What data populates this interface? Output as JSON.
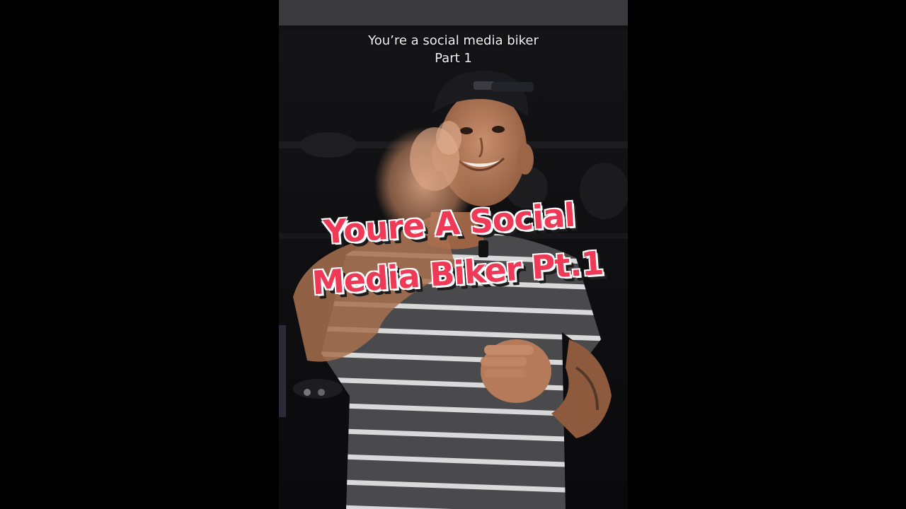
{
  "video": {
    "caption_line1": "You’re a social media biker",
    "caption_line2": "Part 1",
    "overlay_line1": "Youre A Social",
    "overlay_line2": "Media Biker Pt.1"
  },
  "colors": {
    "overlay_fill": "#ee3a57",
    "overlay_stroke": "#ffffff",
    "overlay_shadow": "#1c1c1c",
    "background": "#000000"
  }
}
